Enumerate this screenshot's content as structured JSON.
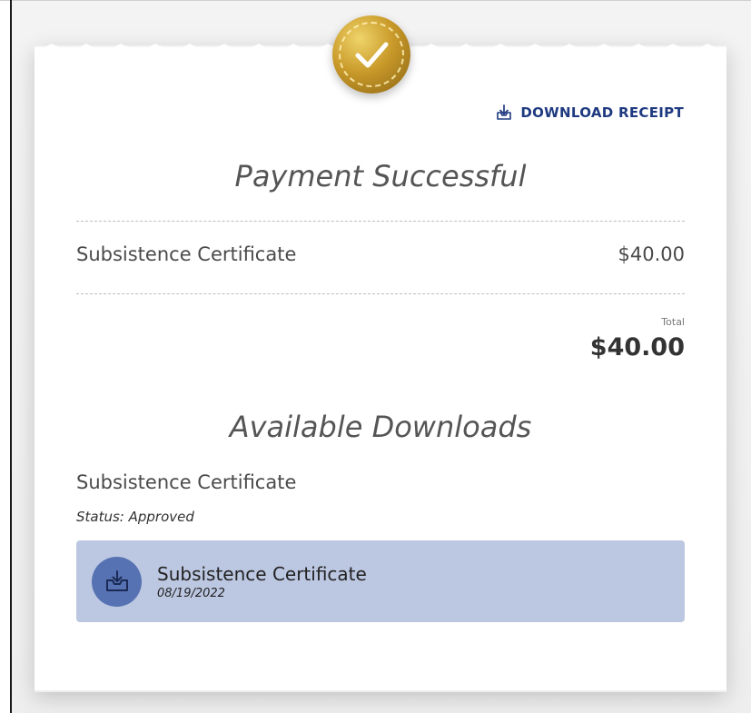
{
  "receipt": {
    "download_label": "DOWNLOAD RECEIPT",
    "title": "Payment Successful",
    "line_items": [
      {
        "name": "Subsistence Certificate",
        "amount": "$40.00"
      }
    ],
    "total_label": "Total",
    "total_value": "$40.00"
  },
  "downloads": {
    "title": "Available Downloads",
    "item_name": "Subsistence Certificate",
    "status": "Status: Approved",
    "file": {
      "name": "Subsistence Certificate",
      "date": "08/19/2022"
    }
  },
  "colors": {
    "accent": "#1f3a80",
    "card": "#bcc7e1",
    "icon_circle": "#5672b3",
    "badge_gold": "#c99a2a"
  },
  "icons": {
    "badge": "checkmark-icon",
    "download_receipt": "download-tray-icon",
    "file": "inbox-download-icon"
  }
}
